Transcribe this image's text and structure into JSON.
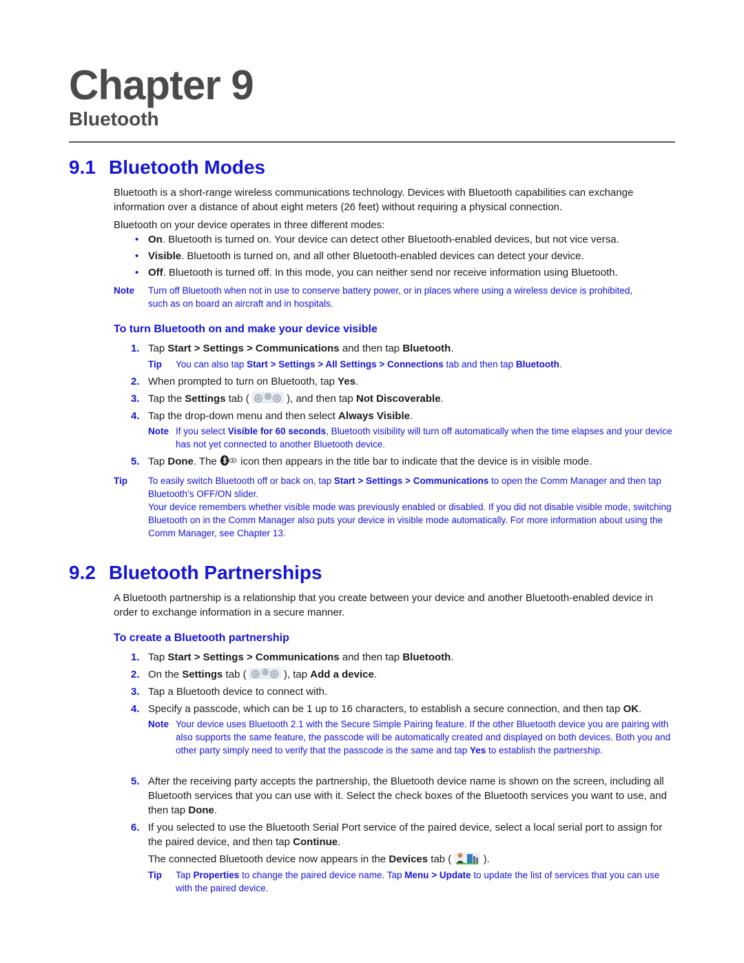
{
  "chapter": {
    "title": "Chapter 9",
    "subtitle": "Bluetooth"
  },
  "section1": {
    "number": "9.1",
    "title": "Bluetooth Modes",
    "intro": "Bluetooth is a short-range wireless communications technology. Devices with Bluetooth capabilities can exchange information over a distance of about eight meters (26 feet) without requiring a physical connection.",
    "modes_intro": "Bluetooth on your device operates in three different modes:",
    "modes": [
      {
        "name": "On",
        "text": ". Bluetooth is turned on. Your device can detect other Bluetooth-enabled devices, but not vice versa."
      },
      {
        "name": "Visible",
        "text": ". Bluetooth is turned on, and all other Bluetooth-enabled devices can detect your device."
      },
      {
        "name": "Off",
        "text": ". Bluetooth is turned off. In this mode, you can neither send nor receive information using Bluetooth."
      }
    ],
    "note": {
      "label": "Note",
      "text": "Turn off Bluetooth when not in use to conserve battery power, or in places where using a wireless device is prohibited, such as on board an aircraft and in hospitals."
    },
    "procedure": {
      "title": "To turn Bluetooth on and make your device visible",
      "steps": [
        {
          "num": "1.",
          "a": "Tap ",
          "b1": "Start > Settings > Communications",
          "c": " and then tap ",
          "b2": "Bluetooth",
          "d": "."
        },
        {
          "num": "2.",
          "a": "When prompted to turn on Bluetooth, tap ",
          "b1": "Yes",
          "d": "."
        },
        {
          "num": "3.",
          "a": "Tap the ",
          "b1": "Settings",
          "c": " tab ( ",
          "c2": " ), and then tap ",
          "b2": "Not Discoverable",
          "d": "."
        },
        {
          "num": "4.",
          "a": "Tap the drop-down menu and then select ",
          "b1": "Always Visible",
          "d": "."
        },
        {
          "num": "5.",
          "a": "Tap ",
          "b1": "Done",
          "c": ". The ",
          "c2": " icon then appears in the title bar to indicate that the device is in visible mode."
        }
      ],
      "tip1": {
        "label": "Tip",
        "a": "You can also tap ",
        "b1": "Start > Settings > All Settings > Connections",
        "c": " tab and then tap ",
        "b2": "Bluetooth",
        "d": "."
      },
      "note4": {
        "label": "Note",
        "a": "If you select ",
        "b1": "Visible for 60 seconds",
        "c": ", Bluetooth visibility will turn off automatically when the time elapses and your device has not yet connected to another Bluetooth device."
      }
    },
    "tip": {
      "label": "Tip",
      "a": "To easily switch Bluetooth off or back on, tap ",
      "b1": "Start > Settings > Communications",
      "c": " to open the Comm Manager and then tap Bluetooth’s OFF/ON slider.",
      "p2": "Your device remembers whether visible mode was previously enabled or disabled. If you did not disable visible mode, switching Bluetooth on in the Comm Manager also puts your device in visible mode automatically. For more information about using the Comm Manager, see Chapter 13."
    }
  },
  "section2": {
    "number": "9.2",
    "title": "Bluetooth Partnerships",
    "intro": "A Bluetooth partnership is a relationship that you create between your device and another Bluetooth-enabled device in order to exchange information in a secure manner.",
    "procedure": {
      "title": "To create a Bluetooth partnership",
      "steps": [
        {
          "num": "1.",
          "a": "Tap ",
          "b1": "Start > Settings > Communications",
          "c": " and then tap ",
          "b2": "Bluetooth",
          "d": "."
        },
        {
          "num": "2.",
          "a": "On the ",
          "b1": "Settings",
          "c": " tab ( ",
          "c2": " ), tap ",
          "b2": "Add a device",
          "d": "."
        },
        {
          "num": "3.",
          "a": "Tap a Bluetooth device to connect with."
        },
        {
          "num": "4.",
          "a": "Specify a passcode, which can be 1 up to 16 characters, to establish a secure connection, and then tap ",
          "b1": "OK",
          "d": "."
        },
        {
          "num": "5.",
          "a": "After the receiving party accepts the partnership, the Bluetooth device name is shown on the screen, including all Bluetooth services that you can use with it. Select the check boxes of the Bluetooth services you want to use, and then tap ",
          "b1": "Done",
          "d": "."
        },
        {
          "num": "6.",
          "a": "If you selected to use the Bluetooth Serial Port service of the paired device, select a local serial port to assign for the paired device, and then tap ",
          "b1": "Continue",
          "d": "."
        }
      ],
      "note4": {
        "label": "Note",
        "a": "Your device uses Bluetooth 2.1 with the Secure Simple Pairing feature. If the other Bluetooth device you are pairing with also supports the same feature, the passcode will be automatically created and displayed on both devices. Both you and other party simply need to verify that the passcode is the same and tap ",
        "b1": "Yes",
        "c": " to establish the partnership."
      },
      "after6": {
        "a": "The connected Bluetooth device now appears in the ",
        "b1": "Devices",
        "c": " tab ( ",
        "d": " )."
      },
      "tip6": {
        "label": "Tip",
        "a": "Tap ",
        "b1": "Properties",
        "c": " to change the paired device name. Tap ",
        "b2": "Menu > Update",
        "d": " to update the list of services that you can use with the paired device."
      }
    }
  },
  "colors": {
    "accent": "#1414d6",
    "heading_gray": "#4a4a4a",
    "body": "#1a1a1a"
  }
}
